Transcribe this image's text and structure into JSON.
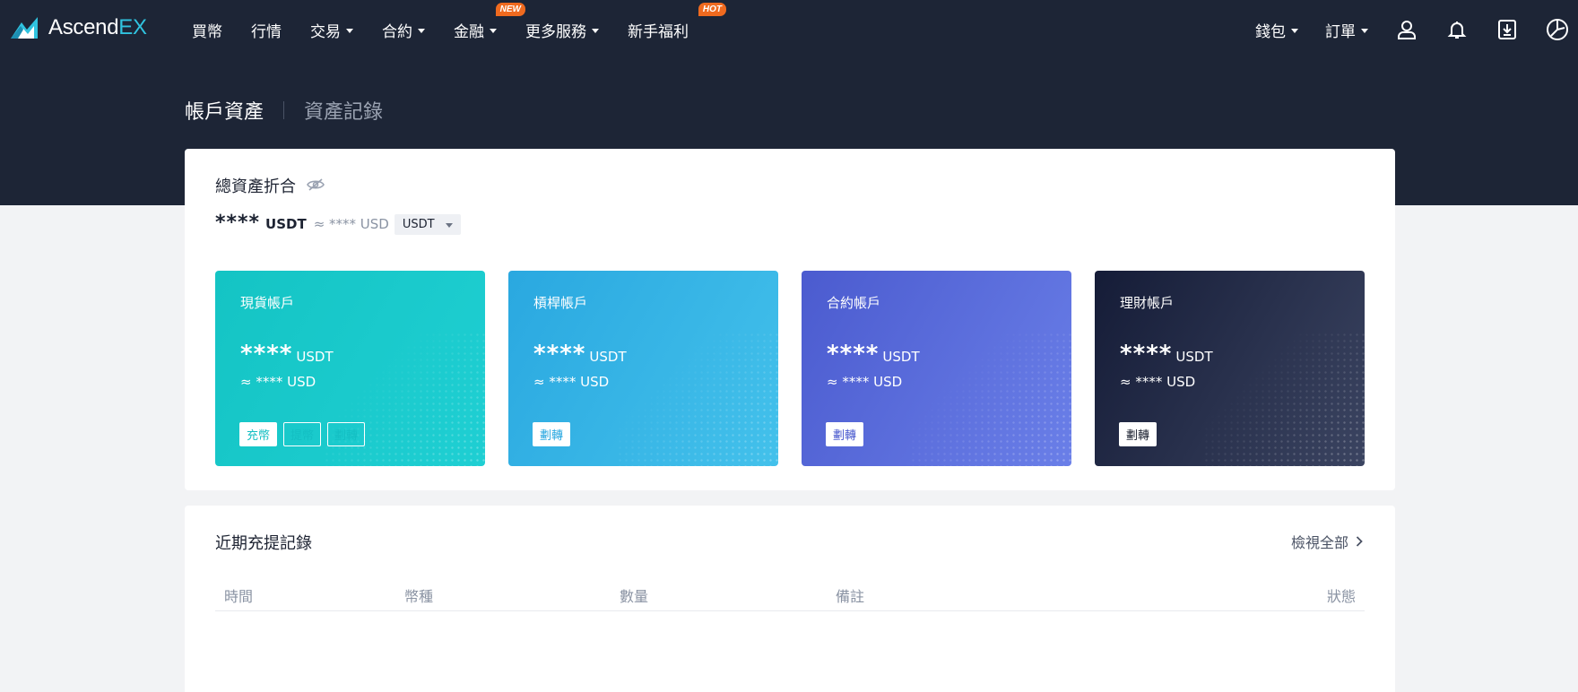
{
  "brand": {
    "name_main": "Ascend",
    "name_accent": "EX",
    "accent_color": "#30c3df"
  },
  "nav": {
    "items": [
      {
        "label": "買幣",
        "caret": false
      },
      {
        "label": "行情",
        "caret": false
      },
      {
        "label": "交易",
        "caret": true
      },
      {
        "label": "合約",
        "caret": true
      },
      {
        "label": "金融",
        "caret": true,
        "badge": "NEW"
      },
      {
        "label": "更多服務",
        "caret": true
      },
      {
        "label": "新手福利",
        "caret": false,
        "badge": "HOT"
      }
    ],
    "right": {
      "wallet": "錢包",
      "orders": "訂單"
    },
    "icons": [
      "user-icon",
      "bell-icon",
      "download-icon",
      "globe-icon"
    ]
  },
  "tabs": {
    "active": "帳戶資產",
    "other": "資產記錄"
  },
  "total": {
    "label": "總資產折合",
    "value": "****",
    "unit": "USDT",
    "approx": "≈ **** USD",
    "unit_select": "USDT"
  },
  "accounts": [
    {
      "title": "現貨帳戶",
      "value": "****",
      "unit": "USDT",
      "usd": "≈ **** USD",
      "buttons": [
        "充幣",
        "提幣",
        "劃轉"
      ]
    },
    {
      "title": "槓桿帳戶",
      "value": "****",
      "unit": "USDT",
      "usd": "≈ **** USD",
      "buttons": [
        "劃轉"
      ]
    },
    {
      "title": "合約帳戶",
      "value": "****",
      "unit": "USDT",
      "usd": "≈ **** USD",
      "buttons": [
        "劃轉"
      ]
    },
    {
      "title": "理財帳戶",
      "value": "****",
      "unit": "USDT",
      "usd": "≈ **** USD",
      "buttons": [
        "劃轉"
      ]
    }
  ],
  "records": {
    "title": "近期充提記錄",
    "view_all": "檢視全部",
    "columns": [
      "時間",
      "幣種",
      "數量",
      "備註",
      "狀態"
    ]
  },
  "colors": {
    "header_bg": "#1d2536",
    "badge_bg": "#ef6a1f",
    "page_bg": "#f2f3f5"
  }
}
